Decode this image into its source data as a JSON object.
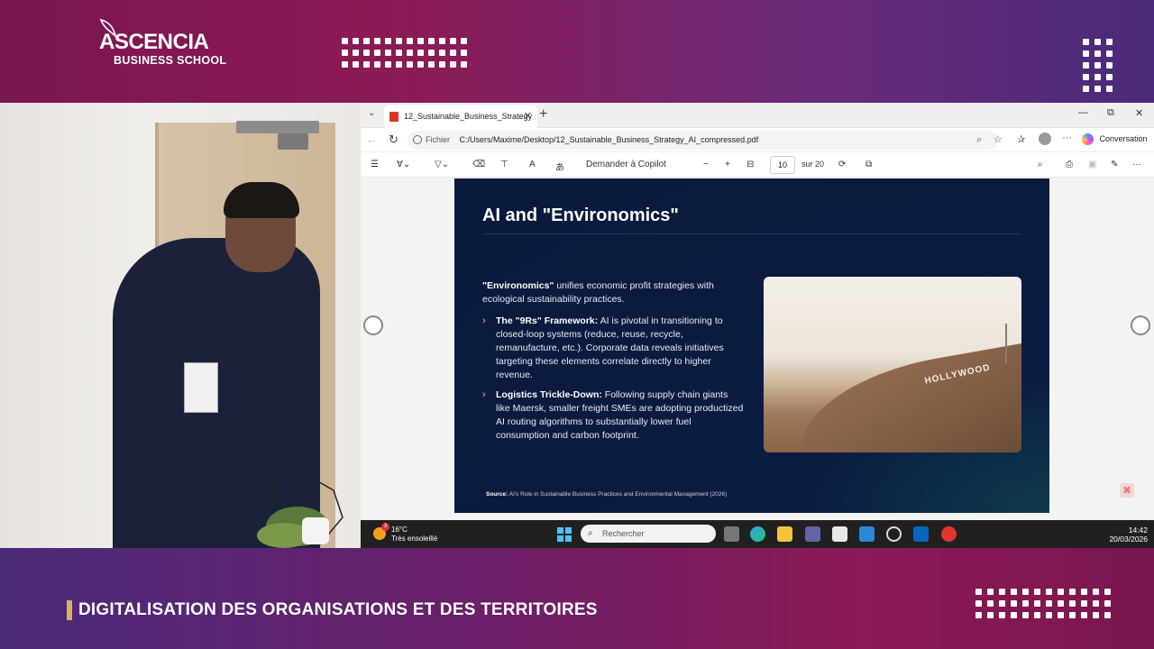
{
  "brand": {
    "name_line1": "ASCENCIA",
    "name_line2": "BUSINESS SCHOOL"
  },
  "footer": {
    "title": "DIGITALISATION DES ORGANISATIONS ET DES TERRITOIRES"
  },
  "browser": {
    "tab_title": "12_Sustainable_Business_Strategy",
    "url_prefix": "Fichier",
    "url": "C:/Users/Maxime/Desktop/12_Sustainable_Business_Strategy_AI_compressed.pdf",
    "conversation_label": "Conversation"
  },
  "pdf_toolbar": {
    "copilot_label": "Demander à Copilot",
    "page_current": "10",
    "page_total": "sur 20"
  },
  "slide": {
    "title": "AI and \"Environomics\"",
    "intro_bold": "\"Environomics\"",
    "intro_text": " unifies economic profit strategies with ecological sustainability practices.",
    "bullets": [
      {
        "bold": "The \"9Rs\" Framework:",
        "text": " AI is pivotal in transitioning to closed-loop systems (reduce, reuse, recycle, remanufacture, etc.). Corporate data reveals initiatives targeting these elements correlate directly to higher revenue."
      },
      {
        "bold": "Logistics Trickle-Down:",
        "text": " Following supply chain giants like Maersk, smaller freight SMEs are adopting productized AI routing algorithms to substantially lower fuel consumption and carbon footprint."
      }
    ],
    "image_text": "HOLLYWOOD",
    "source_label": "Source:",
    "source_text": " AI's Role in Sustainable Business Practices and Environmental Management (2026)"
  },
  "taskbar": {
    "weather_badge": "3",
    "temperature": "16°C",
    "weather_desc": "Très ensoleillé",
    "search_placeholder": "Rechercher",
    "time": "14:42",
    "date": "20/03/2026"
  },
  "icons": [
    "tab-dropdown-icon",
    "pdf-icon",
    "close-icon",
    "plus-icon",
    "back-icon",
    "refresh-icon",
    "info-icon",
    "zoom-icon",
    "favorite-star-icon",
    "collections-icon",
    "profile-icon",
    "more-icon",
    "copilot-icon",
    "minimize-icon",
    "restore-icon",
    "contents-icon",
    "highlight-icon",
    "draw-icon",
    "eraser-icon",
    "text-icon",
    "read-aloud-icon",
    "translate-icon",
    "zoom-out-icon",
    "zoom-in-icon",
    "fit-page-icon",
    "rotate-icon",
    "two-page-icon",
    "search-icon",
    "print-icon",
    "save-icon",
    "save-as-icon",
    "windows-start-icon",
    "task-view-icon",
    "edge-icon",
    "file-explorer-icon",
    "teams-icon",
    "store-icon",
    "mail-icon",
    "chatgpt-icon",
    "outlook-icon",
    "acrobat-icon"
  ]
}
